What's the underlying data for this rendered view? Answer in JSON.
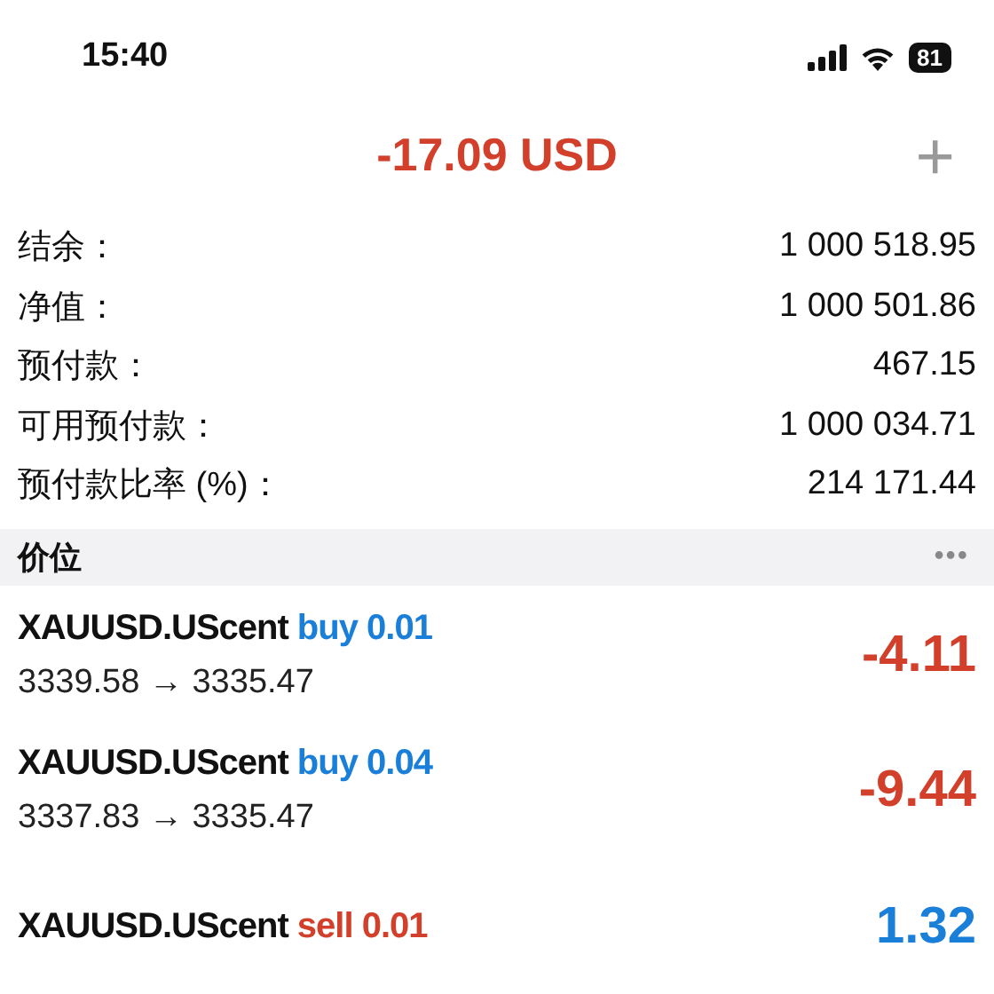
{
  "status_bar": {
    "time": "15:40",
    "battery": "81"
  },
  "header": {
    "title": "-17.09 USD",
    "add_button": "+"
  },
  "summary": [
    {
      "label": "结余：",
      "value": "1 000 518.95"
    },
    {
      "label": "净值：",
      "value": "1 000 501.86"
    },
    {
      "label": "预付款：",
      "value": "467.15"
    },
    {
      "label": "可用预付款：",
      "value": "1 000 034.71"
    },
    {
      "label": "预付款比率 (%)：",
      "value": "214 171.44"
    }
  ],
  "section": {
    "title": "价位",
    "menu": "•••"
  },
  "positions": [
    {
      "symbol": "XAUUSD.UScent",
      "kind": "buy",
      "order": "buy 0.01",
      "prices": "3339.58 → 3335.47",
      "profit": {
        "text": "-4.11",
        "color": "#d23f2a"
      }
    },
    {
      "symbol": "XAUUSD.UScent",
      "kind": "buy",
      "order": "buy 0.04",
      "prices": "3337.83 → 3335.47",
      "profit": {
        "text": "-9.44",
        "color": "#d23f2a"
      }
    },
    {
      "symbol": "XAUUSD.UScent",
      "kind": "sell",
      "order": "sell 0.01",
      "profit": {
        "text": "1.32",
        "color": "#1a7fd9"
      }
    }
  ]
}
